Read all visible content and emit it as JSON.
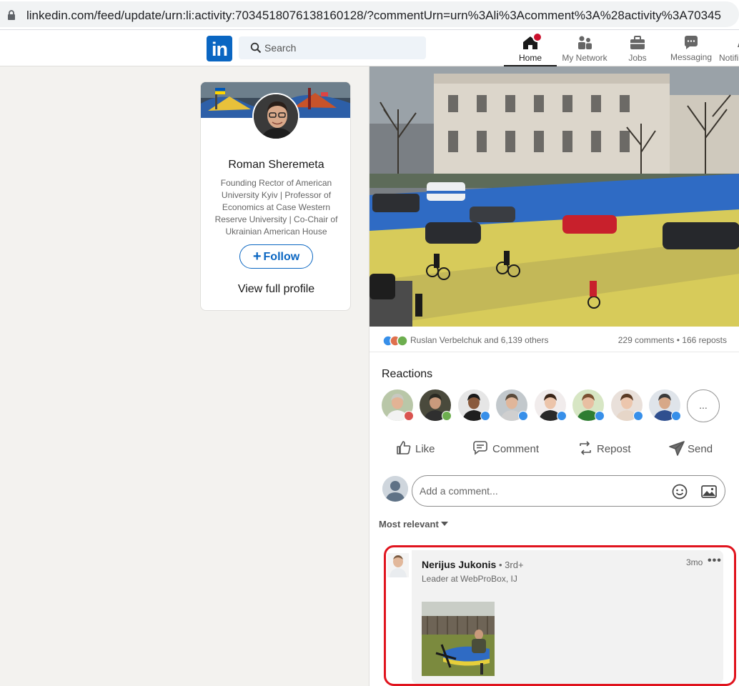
{
  "browser": {
    "url_domain": "linkedin.com",
    "url_rest": "/feed/update/urn:li:activity:7034518076138160128/?commentUrn=urn%3Ali%3Acomment%3A%28activity%3A70345"
  },
  "nav": {
    "search_placeholder": "Search",
    "items": [
      {
        "label": "Home"
      },
      {
        "label": "My Network"
      },
      {
        "label": "Jobs"
      },
      {
        "label": "Messaging"
      },
      {
        "label": "Notifi"
      }
    ],
    "accent": "#0a66c2"
  },
  "profile": {
    "name": "Roman Sheremeta",
    "headline": "Founding Rector of American University Kyiv | Professor of Economics at Case Western Reserve University | Co-Chair of Ukrainian American House",
    "follow_label": "Follow",
    "view_profile_label": "View full profile"
  },
  "post": {
    "reactors_text": "Ruslan Verbelchuk and 6,139 others",
    "counts_text": "229 comments • 166 reposts",
    "reactions_title": "Reactions",
    "more_reactions_label": "...",
    "actions": {
      "like": "Like",
      "comment": "Comment",
      "repost": "Repost",
      "send": "Send"
    },
    "comment_placeholder": "Add a comment...",
    "sort_label": "Most relevant"
  },
  "comment": {
    "author": "Nerijus Jukonis",
    "degree": "• 3rd+",
    "headline": "Leader at WebProBox, IJ",
    "time": "3mo",
    "menu": "•••"
  }
}
